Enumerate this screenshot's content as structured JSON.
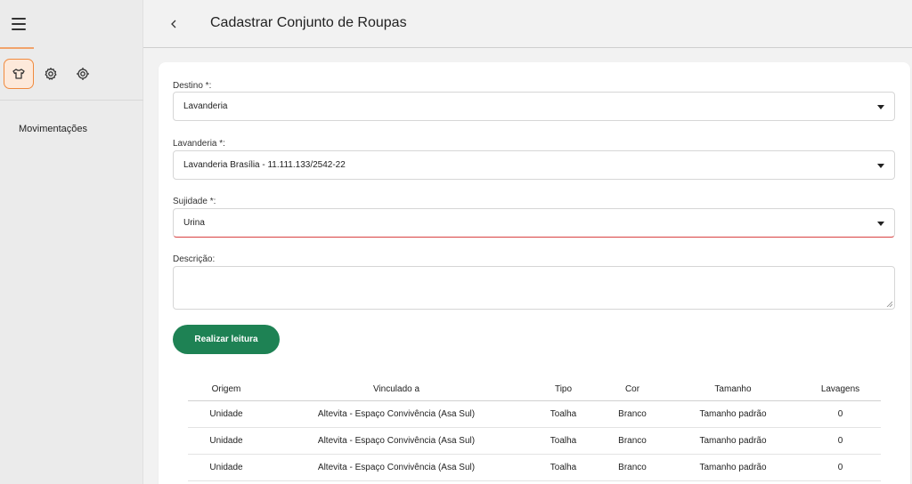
{
  "sidebar": {
    "menu_icon": "hamburger-icon",
    "icons": [
      {
        "name": "laundry-icon",
        "active": true
      },
      {
        "name": "gear-icon",
        "active": false
      },
      {
        "name": "target-icon",
        "active": false
      }
    ],
    "link_label": "Movimentações",
    "accent_color": "#f08a3e"
  },
  "header": {
    "back_icon": "chevron-left-icon",
    "title": "Cadastrar Conjunto de Roupas"
  },
  "form": {
    "destino": {
      "label": "Destino *:",
      "value": "Lavanderia"
    },
    "lavanderia": {
      "label": "Lavanderia *:",
      "value": "Lavanderia Brasília - 11.111.133/2542-22"
    },
    "sujidade": {
      "label": "Sujidade *:",
      "value": "Urina"
    },
    "descricao": {
      "label": "Descrição:",
      "value": ""
    },
    "read_button": "Realizar leitura",
    "primary_color": "#1e8254",
    "error_color": "#d94141"
  },
  "table": {
    "headers": [
      "Origem",
      "Vinculado a",
      "Tipo",
      "Cor",
      "Tamanho",
      "Lavagens"
    ],
    "rows": [
      [
        "Unidade",
        "Altevita - Espaço Convivência (Asa Sul)",
        "Toalha",
        "Branco",
        "Tamanho padrão",
        "0"
      ],
      [
        "Unidade",
        "Altevita - Espaço Convivência (Asa Sul)",
        "Toalha",
        "Branco",
        "Tamanho padrão",
        "0"
      ],
      [
        "Unidade",
        "Altevita - Espaço Convivência (Asa Sul)",
        "Toalha",
        "Branco",
        "Tamanho padrão",
        "0"
      ]
    ]
  }
}
